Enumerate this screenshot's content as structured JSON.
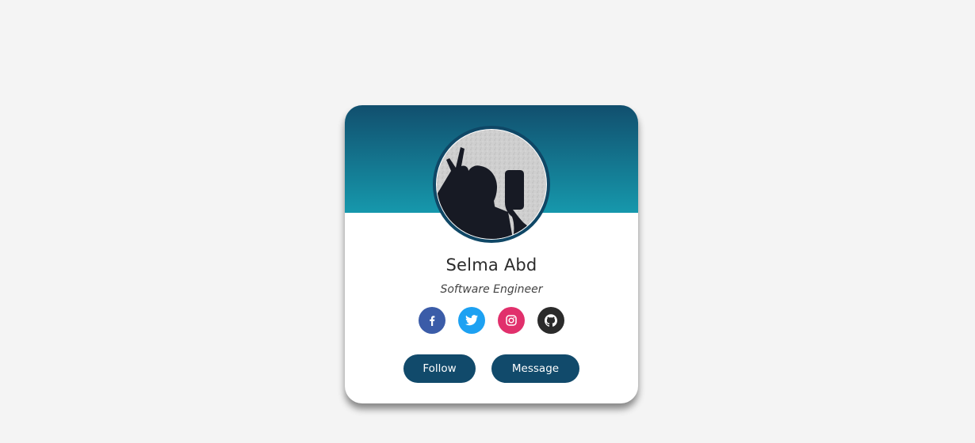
{
  "profile": {
    "name": "Selma Abd",
    "title": "Software Engineer"
  },
  "socials": [
    {
      "icon": "facebook-icon",
      "color": "#3b5ca8"
    },
    {
      "icon": "twitter-icon",
      "color": "#1da1f2"
    },
    {
      "icon": "instagram-icon",
      "color": "#e1306c"
    },
    {
      "icon": "github-icon",
      "color": "#2b2b2b"
    }
  ],
  "actions": {
    "follow_label": "Follow",
    "message_label": "Message"
  },
  "colors": {
    "header_top": "#114f6e",
    "header_bottom": "#1698ac",
    "button": "#114a6b",
    "background": "#f4f4f4"
  }
}
